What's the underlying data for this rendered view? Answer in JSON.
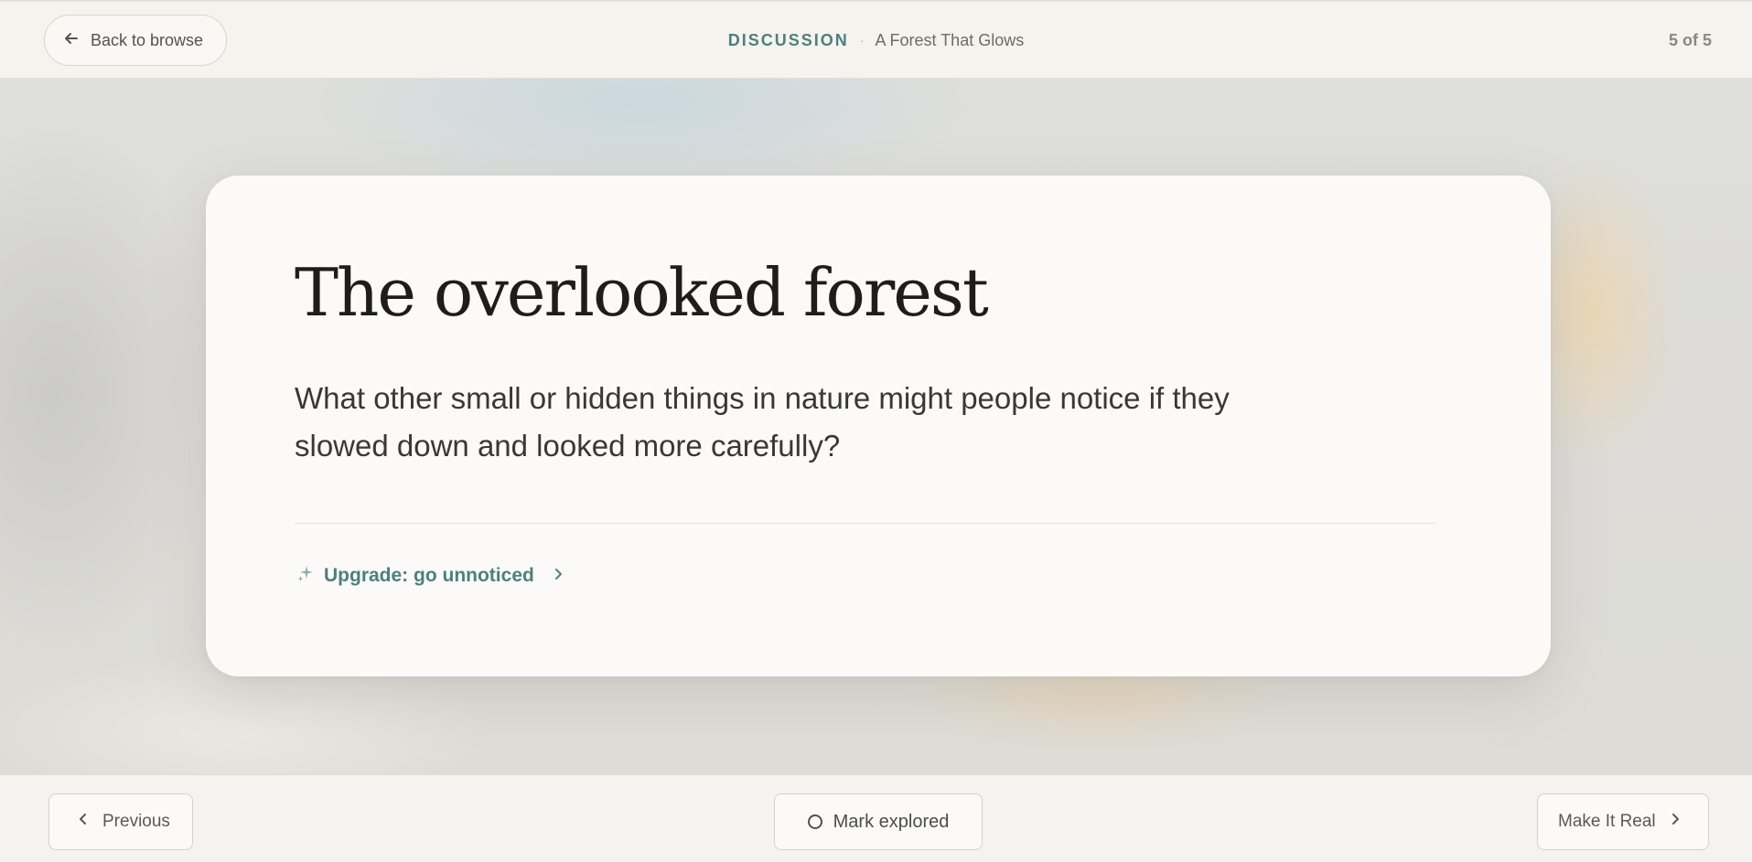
{
  "header": {
    "back_label": "Back to browse",
    "section_label": "DISCUSSION",
    "separator": "·",
    "story_title": "A Forest That Glows",
    "progress": "5 of 5"
  },
  "card": {
    "title": "The overlooked forest",
    "question": "What other small or hidden things in nature might people notice if they slowed down and looked more carefully?",
    "upgrade_label": "Upgrade: go unnoticed"
  },
  "footer": {
    "previous_label": "Previous",
    "mark_label": "Mark explored",
    "next_label": "Make It Real"
  },
  "colors": {
    "accent": "#4d7f7f",
    "bar_background": "#f6f3ee",
    "card_background": "#fcfbf9",
    "title_text": "#1f1d1a"
  },
  "icons": {
    "back": "arrow-left-icon",
    "upgrade": "sparkle-icon",
    "upgrade_chevron": "chevron-right-icon",
    "previous": "chevron-left-icon",
    "mark": "circle-icon",
    "next": "chevron-right-icon"
  }
}
